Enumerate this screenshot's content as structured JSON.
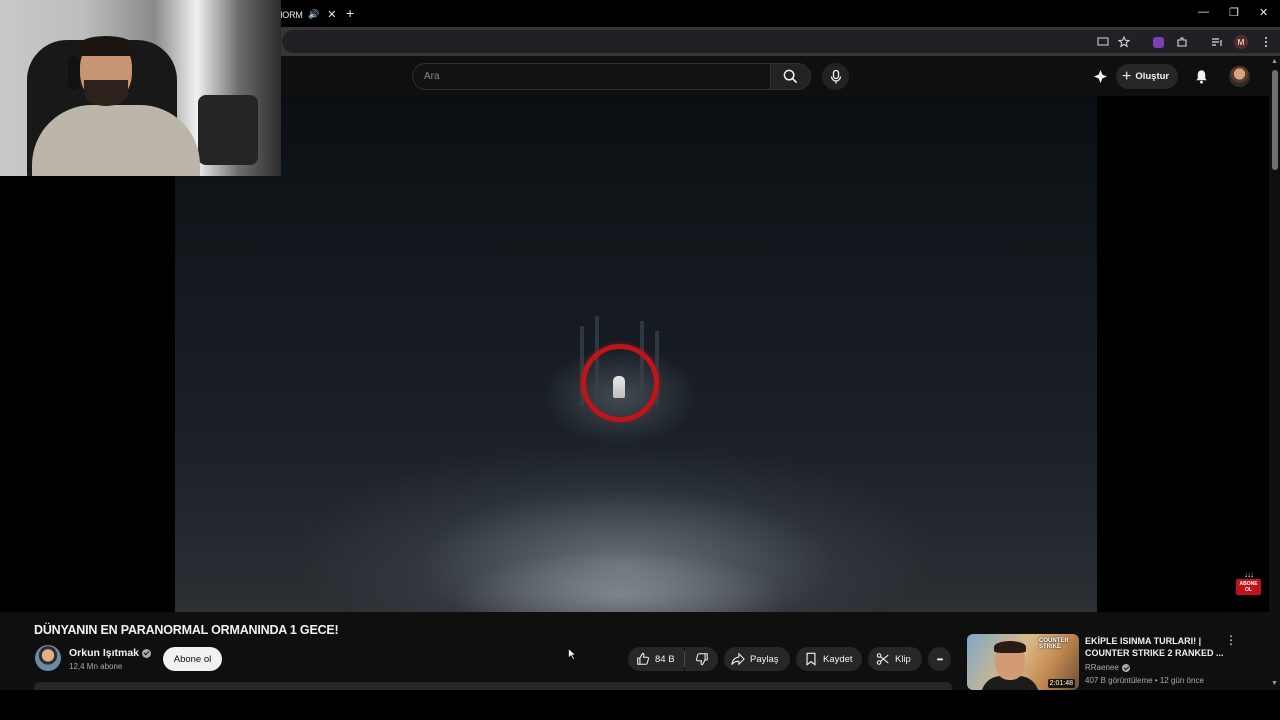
{
  "browser": {
    "tab": {
      "title": "NORM",
      "audio_icon": "🔊",
      "close_icon": "✕"
    },
    "new_tab_icon": "+",
    "window_controls": {
      "minimize": "—",
      "maximize": "❐",
      "close": "✕"
    },
    "profile_initial": "M"
  },
  "masthead": {
    "search_placeholder": "Ara",
    "create_label": "Oluştur"
  },
  "video": {
    "overlay_badge": {
      "arrows": "↓↓↓",
      "text": "ABONE OL"
    }
  },
  "info": {
    "title": "DÜNYANIN EN PARANORMAL ORMANINDA 1 GECE!",
    "channel_name": "Orkun Işıtmak",
    "subscribers": "12,4 Mn abone",
    "subscribe_label": "Abone ol",
    "like_count": "84 B",
    "share_label": "Paylaş",
    "save_label": "Kaydet",
    "clip_label": "Klip",
    "more_label": "•••"
  },
  "recommended": {
    "title": "EKİPLE ISINMA TURLARI! | COUNTER STRIKE 2 RANKED ...",
    "channel": "RRaenee",
    "meta": "407 B görüntüleme • 12 gün önce",
    "duration": "2:01:48",
    "thumb_logo": "COUNTER STRIKE",
    "menu_icon": "⋮"
  },
  "colors": {
    "background": "#0f0f0f",
    "accent_red": "#c0141b",
    "pill_bg": "#272727"
  }
}
